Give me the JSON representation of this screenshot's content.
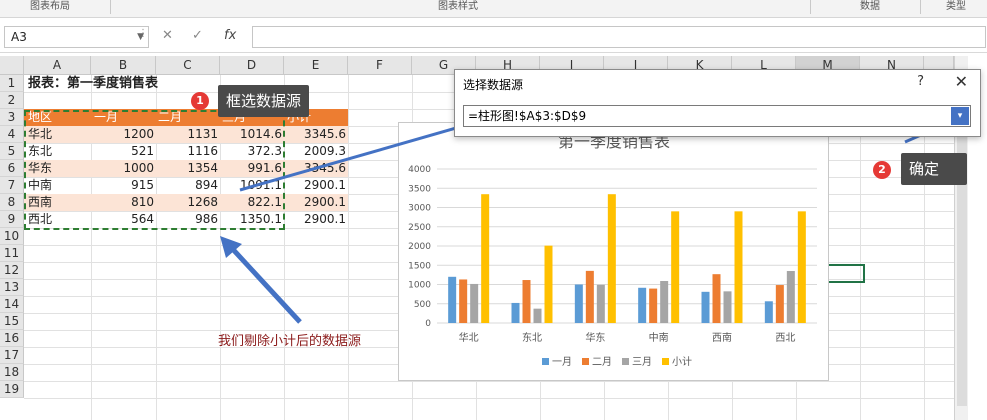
{
  "ribbon": {
    "groups": [
      "图表布局",
      "图表样式",
      "数据",
      "类型"
    ]
  },
  "formula_bar": {
    "name_box": "A3",
    "cancel_icon": "✕",
    "enter_icon": "✓",
    "fx_label": "fx",
    "formula": ""
  },
  "sheet": {
    "columns": [
      "A",
      "B",
      "C",
      "D",
      "E",
      "F",
      "G",
      "H",
      "I",
      "J",
      "K",
      "L",
      "M",
      "N"
    ],
    "rows": [
      "1",
      "2",
      "3",
      "4",
      "5",
      "6",
      "7",
      "8",
      "9",
      "10",
      "11",
      "12",
      "13",
      "14",
      "15",
      "16",
      "17",
      "18",
      "19"
    ],
    "title": "报表：第一季度销售表",
    "header": [
      "地区",
      "一月",
      "二月",
      "三月",
      "小计"
    ],
    "data": [
      [
        "华北",
        "1200",
        "1131",
        "1014.6",
        "3345.6"
      ],
      [
        "东北",
        "521",
        "1116",
        "372.3",
        "2009.3"
      ],
      [
        "华东",
        "1000",
        "1354",
        "991.6",
        "3345.6"
      ],
      [
        "中南",
        "915",
        "894",
        "1091.1",
        "2900.1"
      ],
      [
        "西南",
        "810",
        "1268",
        "822.1",
        "2900.1"
      ],
      [
        "西北",
        "564",
        "986",
        "1350.1",
        "2900.1"
      ]
    ],
    "header_color": "#ed7d31",
    "band_color": "#fce4d6"
  },
  "dialog": {
    "title": "选择数据源",
    "help": "?",
    "close": "✕",
    "range": "=柱形图!$A$3:$D$9",
    "collapse_icon": "▾"
  },
  "callouts": {
    "step1_num": "1",
    "step1": "框选数据源",
    "step2_num": "2",
    "step2": "确定",
    "note": "我们剔除小计后的数据源"
  },
  "chart_data": {
    "type": "bar",
    "title": "第一季度销售表",
    "categories": [
      "华北",
      "东北",
      "华东",
      "中南",
      "西南",
      "西北"
    ],
    "series": [
      {
        "name": "一月",
        "color": "#5b9bd5",
        "values": [
          1200,
          521,
          1000,
          915,
          810,
          564
        ]
      },
      {
        "name": "二月",
        "color": "#ed7d31",
        "values": [
          1131,
          1116,
          1354,
          894,
          1268,
          986
        ]
      },
      {
        "name": "三月",
        "color": "#a5a5a5",
        "values": [
          1014.6,
          372.3,
          991.6,
          1091.1,
          822.1,
          1350.1
        ]
      },
      {
        "name": "小计",
        "color": "#ffc000",
        "values": [
          3345.6,
          2009.3,
          3345.6,
          2900.1,
          2900.1,
          2900.1
        ]
      }
    ],
    "yticks": [
      "0",
      "500",
      "1000",
      "1500",
      "2000",
      "2500",
      "3000",
      "3500",
      "4000"
    ],
    "ylim": [
      0,
      4000
    ],
    "grid": true,
    "legend": "bottom"
  }
}
